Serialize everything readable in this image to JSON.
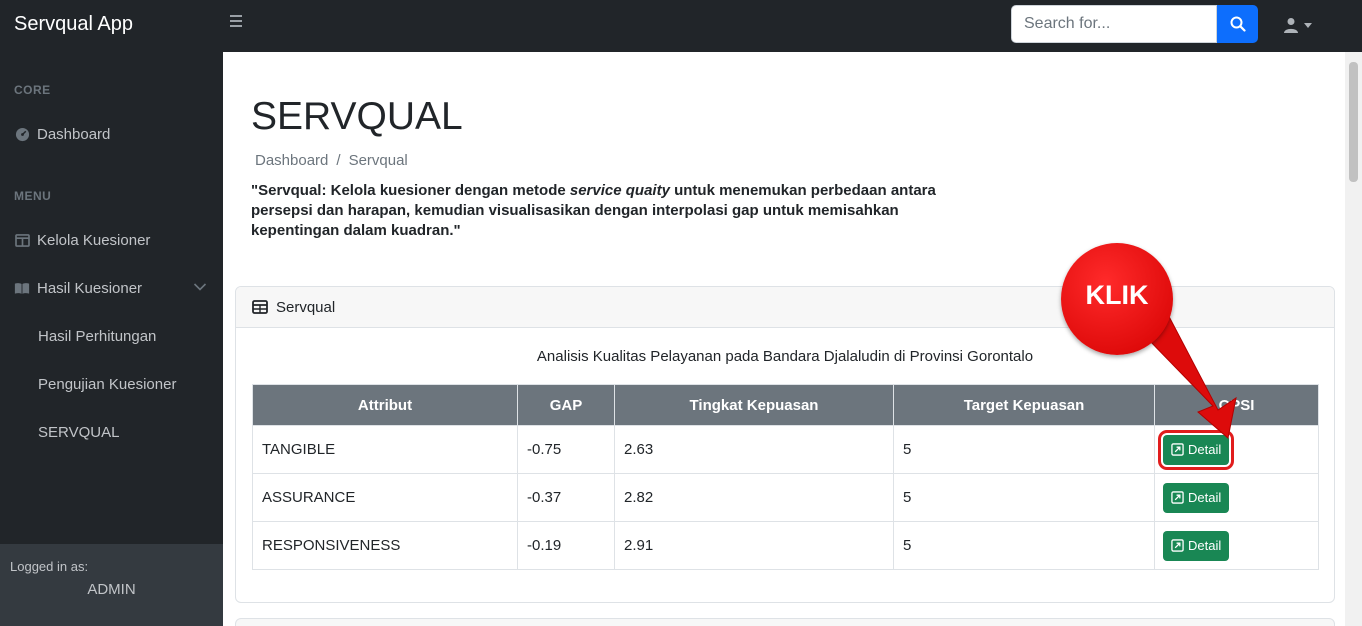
{
  "app": {
    "brand": "Servqual App"
  },
  "topbar": {
    "search_placeholder": "Search for...",
    "search_icon": "search-icon",
    "user_icon": "user-icon"
  },
  "sidebar": {
    "core_heading": "CORE",
    "dashboard_label": "Dashboard",
    "menu_heading": "MENU",
    "kelola_label": "Kelola Kuesioner",
    "hasil_label": "Hasil Kuesioner",
    "sub_items": [
      "Hasil Perhitungan",
      "Pengujian Kuesioner",
      "SERVQUAL"
    ],
    "footer": {
      "logged_label": "Logged in as:",
      "user": "ADMIN"
    }
  },
  "main": {
    "title": "SERVQUAL",
    "breadcrumb": {
      "home": "Dashboard",
      "separator": "/",
      "current": "Servqual"
    },
    "description": {
      "part1": "\"Servqual: Kelola kuesioner dengan metode ",
      "emphasis": "service quaity",
      "part2": " untuk menemukan perbedaan antara persepsi dan harapan, kemudian visualisasikan dengan interpolasi gap untuk memisahkan kepentingan dalam kuadran.\""
    }
  },
  "card": {
    "header": "Servqual",
    "caption": "Analisis Kualitas Pelayanan pada Bandara Djalaludin di Provinsi Gorontalo",
    "columns": [
      "Attribut",
      "GAP",
      "Tingkat Kepuasan",
      "Target Kepuasan",
      "OPSI"
    ],
    "rows": [
      {
        "attribut": "TANGIBLE",
        "gap": "-0.75",
        "tingkat": "2.63",
        "target": "5",
        "action": "Detail"
      },
      {
        "attribut": "ASSURANCE",
        "gap": "-0.37",
        "tingkat": "2.82",
        "target": "5",
        "action": "Detail"
      },
      {
        "attribut": "RESPONSIVENESS",
        "gap": "-0.19",
        "tingkat": "2.91",
        "target": "5",
        "action": "Detail"
      }
    ]
  },
  "annotation": {
    "label": "KLIK",
    "color": "#e11d1d"
  },
  "colors": {
    "navbar": "#212529",
    "sidebar_footer": "#343a40",
    "primary": "#0d6efd",
    "success": "#198754",
    "table_header": "#6c757d"
  }
}
